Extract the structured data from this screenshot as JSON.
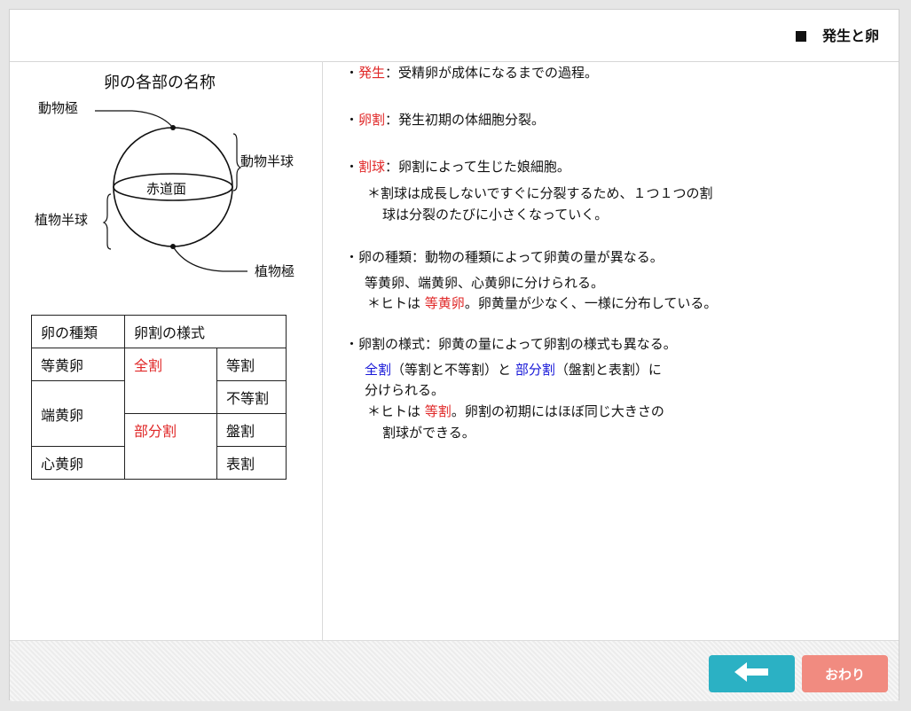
{
  "header": {
    "title": "発生と卵"
  },
  "diagram": {
    "title": "卵の各部の名称",
    "labels": {
      "animal_pole": "動物極",
      "animal_hemisphere": "動物半球",
      "equator": "赤道面",
      "vegetal_hemisphere": "植物半球",
      "vegetal_pole": "植物極"
    }
  },
  "table": {
    "headers": [
      "卵の種類",
      "卵割の様式"
    ],
    "rows": {
      "isolecithal": "等黄卵",
      "telolecithal": "端黄卵",
      "centrolecithal": "心黄卵",
      "holoblastic": "全割",
      "meroblastic": "部分割",
      "equal": "等割",
      "unequal": "不等割",
      "discoidal": "盤割",
      "superficial": "表割"
    }
  },
  "content": {
    "hassei": {
      "bullet": "・",
      "term": "発生",
      "text": "：受精卵が成体になるまでの過程。"
    },
    "rankatsu": {
      "bullet": "・",
      "term": "卵割",
      "text": "：発生初期の体細胞分裂。"
    },
    "kakkyu": {
      "bullet": "・",
      "term": "割球",
      "text": "：卵割によって生じた娘細胞。",
      "note1": "＊割球は成長しないですぐに分裂するため、１つ１つの割",
      "note2": "球は分裂のたびに小さくなっていく。"
    },
    "kinds": {
      "heading": "・卵の種類：動物の種類によって卵黄の量が異なる。",
      "line1": "等黄卵、端黄卵、心黄卵に分けられる。",
      "note_pre": "＊ヒトは",
      "note_term": "等黄卵",
      "note_post": "。卵黄量が少なく、一様に分布している。"
    },
    "styles": {
      "heading": "・卵割の様式：卵黄の量によって卵割の様式も異なる。",
      "term1": "全割",
      "paren1": "（等割と不等割）と",
      "term2": "部分割",
      "paren2": "（盤割と表割）に",
      "line2": "分けられる。",
      "note_pre": "＊ヒトは",
      "note_term": "等割",
      "note_post": "。卵割の初期にはほぼ同じ大きさの",
      "note_line2": "割球ができる。"
    }
  },
  "buttons": {
    "back_icon": "left-arrow-icon",
    "end_label": "おわり"
  },
  "colors": {
    "red": "#e02828",
    "blue": "#1818d8",
    "back_button": "#2bb1c4",
    "end_button": "#f18b80"
  }
}
